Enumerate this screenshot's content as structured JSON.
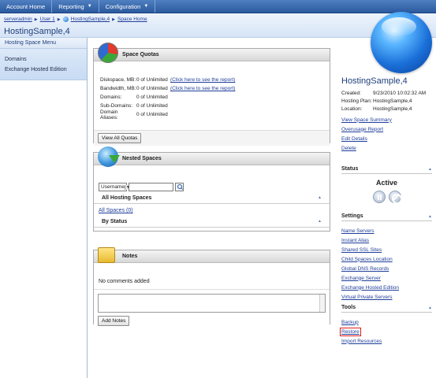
{
  "nav": {
    "items": [
      {
        "label": "Account Home",
        "dropdown": false
      },
      {
        "label": "Reporting",
        "dropdown": true
      },
      {
        "label": "Configuration",
        "dropdown": true
      }
    ]
  },
  "breadcrumb": [
    "serveradmin",
    "User 1",
    "HostingSample,4",
    "Space Home"
  ],
  "page_title": "HostingSample,4",
  "left_menu": {
    "title": "Hosting Space Menu",
    "items": [
      "Domains",
      "Exchange Hosted Edition"
    ]
  },
  "quotas": {
    "title": "Space Quotas",
    "rows": [
      {
        "label": "Diskspace, MB:",
        "value": "0 of Unlimited",
        "link": "(Click here to see the report)"
      },
      {
        "label": "Bandwidth, MB:",
        "value": "0 of Unlimited",
        "link": "(Click here to see the report)"
      },
      {
        "label": "Domains:",
        "value": "0 of Unlimited",
        "link": ""
      },
      {
        "label": "Sub-Domains:",
        "value": "0 of Unlimited",
        "link": ""
      },
      {
        "label": "Domain Aliases:",
        "value": "0 of Unlimited",
        "link": ""
      }
    ],
    "button": "View All Quotas"
  },
  "nested": {
    "title": "Nested Spaces",
    "select_value": "Username",
    "all_heading": "All Hosting Spaces",
    "all_link": "All Spaces (0)",
    "by_status": "By Status"
  },
  "notes": {
    "title": "Notes",
    "empty_text": "No comments added",
    "button": "Add Notes"
  },
  "right": {
    "title": "HostingSample,4",
    "details": [
      {
        "label": "Created:",
        "value": "9/23/2010 10:02:32 AM"
      },
      {
        "label": "Hosting Plan:",
        "value": "HostingSample,4"
      },
      {
        "label": "Location:",
        "value": "HostingSample,4"
      }
    ],
    "actions": [
      "View Space Summary",
      "Overusage Report",
      "Edit Details",
      "Delete"
    ],
    "status_heading": "Status",
    "status_value": "Active",
    "settings_heading": "Settings",
    "settings": [
      "Name Servers",
      "Instant Alias",
      "Shared SSL Sites",
      "Child Spaces Location",
      "Global DNS Records",
      "Exchange Server",
      "Exchange Hosted Edition",
      "Virtual Private Servers"
    ],
    "tools_heading": "Tools",
    "tools": [
      "Backup",
      "Restore",
      "Import Resources"
    ]
  },
  "colors": {
    "nav_bg": "#2b5a9f",
    "link": "#1f3e9a",
    "highlight": "#e31b1b"
  }
}
